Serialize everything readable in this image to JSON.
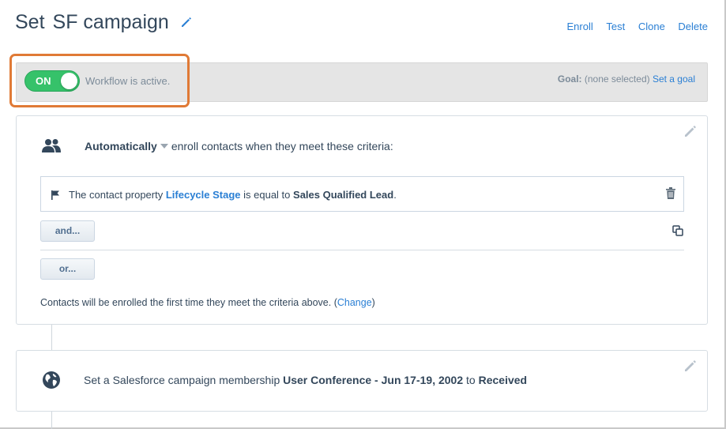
{
  "header": {
    "title_prefix": "Set",
    "title_name": "SF campaign",
    "actions": [
      "Enroll",
      "Test",
      "Clone",
      "Delete"
    ]
  },
  "status": {
    "toggle_label": "ON",
    "toggle_on": true,
    "active_text": "Workflow is active.",
    "goal_label": "Goal:",
    "goal_value": "(none selected)",
    "goal_link": "Set a goal"
  },
  "enrollment": {
    "mode": "Automatically",
    "mode_suffix": "enroll contacts when they meet these criteria:",
    "criteria": {
      "prefix": "The contact property",
      "property": "Lifecycle Stage",
      "operator": "is equal to",
      "value": "Sales Qualified Lead",
      "end": "."
    },
    "and_label": "and...",
    "or_label": "or...",
    "footer_text": "Contacts will be enrolled the first time they meet the criteria above. (",
    "footer_link": "Change",
    "footer_end": ")"
  },
  "action": {
    "prefix": "Set a Salesforce campaign membership",
    "campaign": "User Conference - Jun 17-19, 2002",
    "to": "to",
    "status": "Received"
  },
  "colors": {
    "accent": "#2a7fd4",
    "toggle_green": "#36c26a",
    "highlight_orange": "#e07a36",
    "text": "#33475b"
  }
}
